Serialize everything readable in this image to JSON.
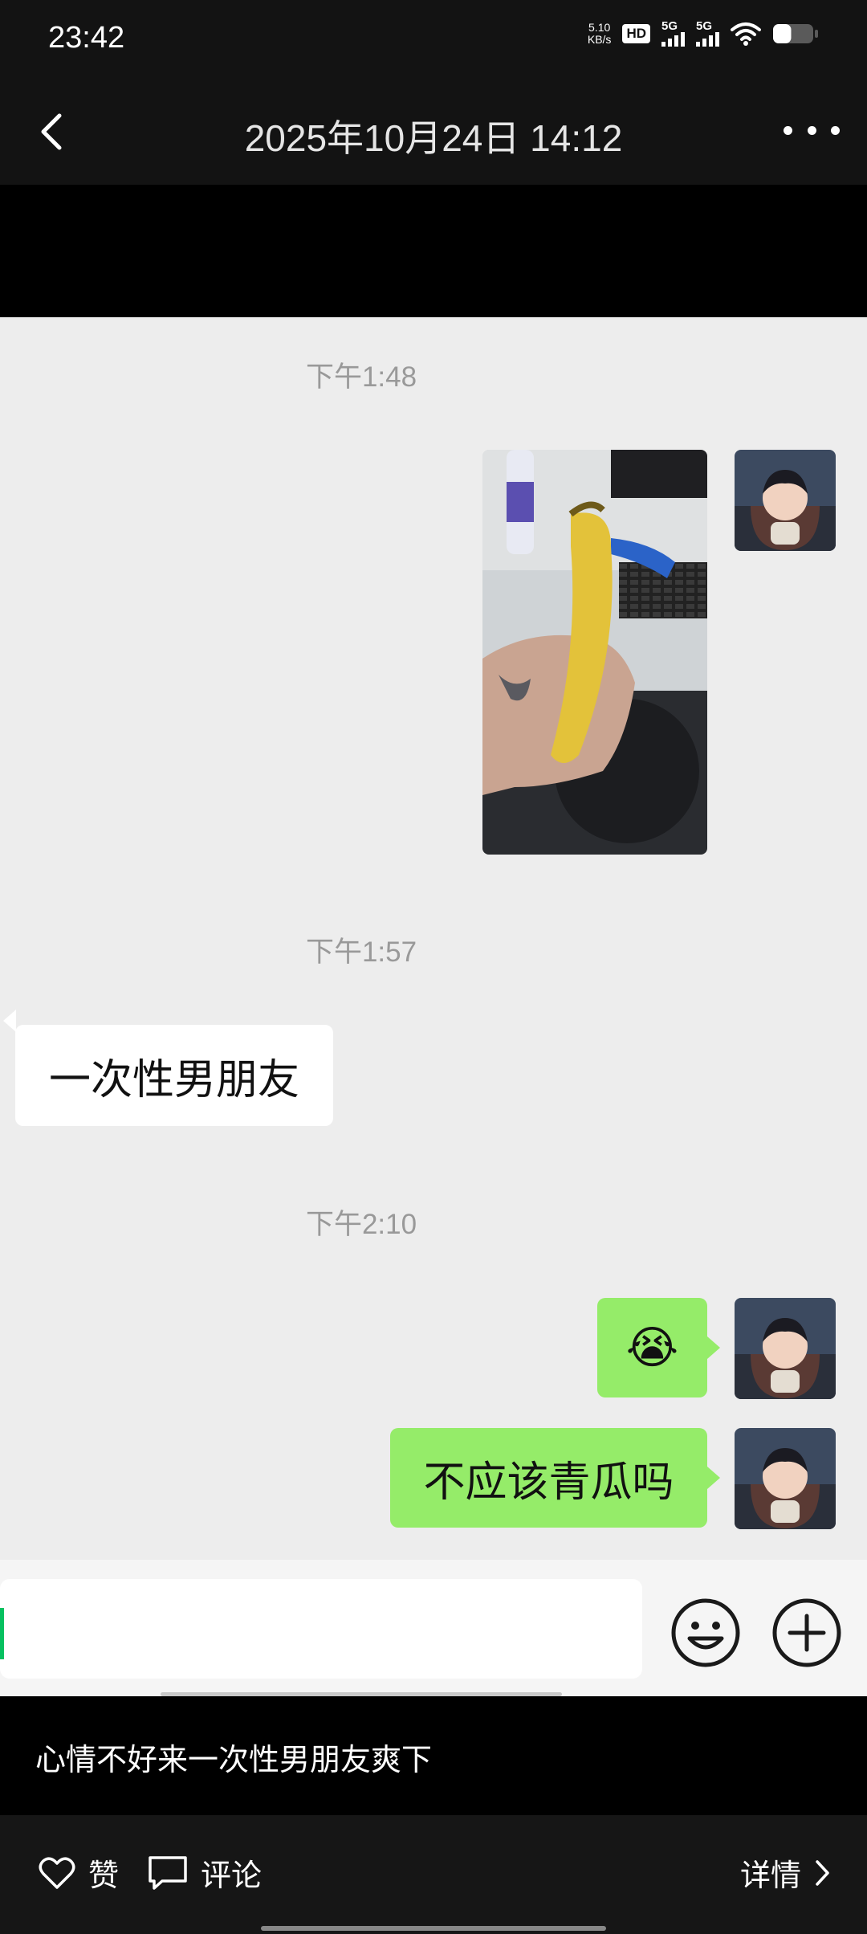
{
  "status_bar": {
    "time": "23:42",
    "net_speed_value": "5.10",
    "net_speed_unit": "KB/s",
    "hd_label": "HD",
    "sim1_label": "5G",
    "sim2_label": "5G",
    "battery_level": 0.45
  },
  "header": {
    "title": "2025年10月24日 14:12"
  },
  "chat": {
    "timestamps": [
      "下午1:48",
      "下午1:57",
      "下午2:10"
    ],
    "messages": [
      {
        "side": "right",
        "type": "image",
        "content": "banana photo"
      },
      {
        "side": "left",
        "type": "text",
        "text": "一次性男朋友"
      },
      {
        "side": "right",
        "type": "emoji",
        "text": "😭"
      },
      {
        "side": "right",
        "type": "text",
        "text": "不应该青瓜吗"
      }
    ]
  },
  "caption": {
    "text": "心情不好来一次性男朋友爽下"
  },
  "actions": {
    "like_label": "赞",
    "comment_label": "评论",
    "details_label": "详情"
  },
  "colors": {
    "chat_bg": "#ededed",
    "green_bubble": "#95ec69",
    "cursor": "#07c160"
  },
  "icons": [
    "back-arrow-icon",
    "more-icon",
    "emoji-icon",
    "plus-icon",
    "heart-icon",
    "comment-icon",
    "chevron-right-icon",
    "wifi-icon",
    "battery-icon"
  ]
}
